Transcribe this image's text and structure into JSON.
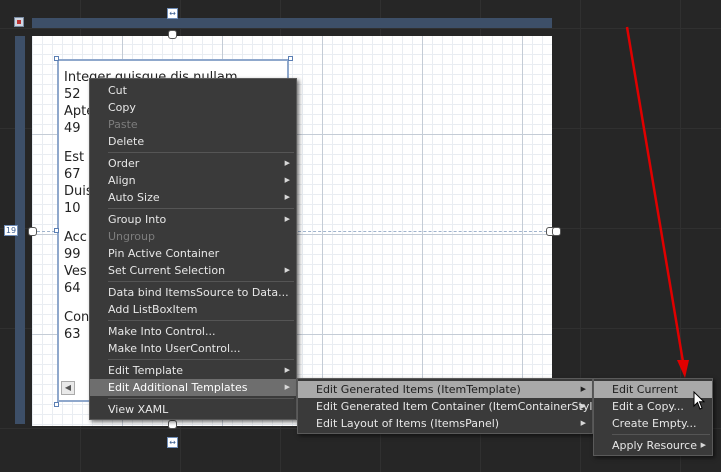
{
  "listbox": {
    "items": [
      {
        "text": "Integer quisque dis nullam",
        "value": "52"
      },
      {
        "text": "Aptent",
        "value": "49"
      },
      {
        "text": "Est",
        "value": "67"
      },
      {
        "text": "Duis",
        "value": "10"
      },
      {
        "text": "Acc",
        "value": "99"
      },
      {
        "text": "Ves",
        "value": "64"
      },
      {
        "text": "Con",
        "value": "63"
      }
    ]
  },
  "adorners": {
    "left_margin_value": "19"
  },
  "context_menu": {
    "items": [
      {
        "label": "Cut",
        "enabled": true,
        "submenu": false
      },
      {
        "label": "Copy",
        "enabled": true,
        "submenu": false
      },
      {
        "label": "Paste",
        "enabled": false,
        "submenu": false
      },
      {
        "label": "Delete",
        "enabled": true,
        "submenu": false
      },
      {
        "label": "Order",
        "enabled": true,
        "submenu": true
      },
      {
        "label": "Align",
        "enabled": true,
        "submenu": true
      },
      {
        "label": "Auto Size",
        "enabled": true,
        "submenu": true
      },
      {
        "label": "Group Into",
        "enabled": true,
        "submenu": true
      },
      {
        "label": "Ungroup",
        "enabled": false,
        "submenu": false
      },
      {
        "label": "Pin Active Container",
        "enabled": true,
        "submenu": false
      },
      {
        "label": "Set Current Selection",
        "enabled": true,
        "submenu": true
      },
      {
        "label": "Data bind ItemsSource to Data...",
        "enabled": true,
        "submenu": false
      },
      {
        "label": "Add ListBoxItem",
        "enabled": true,
        "submenu": false
      },
      {
        "label": "Make Into Control...",
        "enabled": true,
        "submenu": false
      },
      {
        "label": "Make Into UserControl...",
        "enabled": true,
        "submenu": false
      },
      {
        "label": "Edit Template",
        "enabled": true,
        "submenu": true
      },
      {
        "label": "Edit Additional Templates",
        "enabled": true,
        "submenu": true
      },
      {
        "label": "View XAML",
        "enabled": true,
        "submenu": false
      }
    ]
  },
  "submenu_additional_templates": {
    "items": [
      {
        "label": "Edit Generated Items (ItemTemplate)"
      },
      {
        "label": "Edit Generated Item Container (ItemContainerStyle)"
      },
      {
        "label": "Edit Layout of Items (ItemsPanel)"
      }
    ]
  },
  "submenu_generated_items": {
    "items": [
      {
        "label": "Edit Current"
      },
      {
        "label": "Edit a Copy..."
      },
      {
        "label": "Create Empty..."
      },
      {
        "label": "Apply Resource"
      }
    ]
  },
  "colors": {
    "canvas_bg": "#262626",
    "menu_bg": "#3a3a3a",
    "highlight": "#6e6e6e",
    "annotation_arrow": "#e00000"
  }
}
